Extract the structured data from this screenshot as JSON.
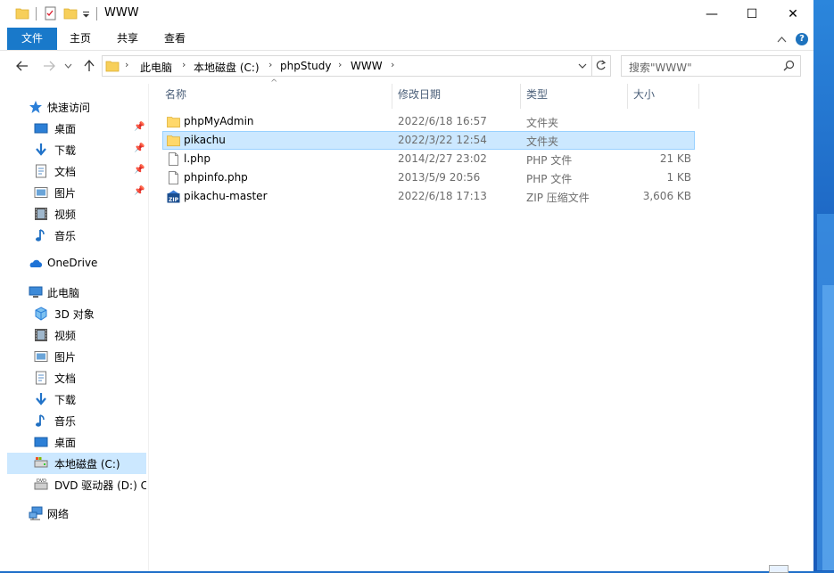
{
  "window": {
    "title": "WWW",
    "controls": {
      "minimize": "—",
      "maximize": "☐",
      "close": "✕"
    }
  },
  "ribbon": {
    "tabs": [
      "文件",
      "主页",
      "共享",
      "查看"
    ],
    "help": "?"
  },
  "address": {
    "crumbs": [
      "此电脑",
      "本地磁盘 (C:)",
      "phpStudy",
      "WWW"
    ],
    "search_placeholder": "搜索\"WWW\""
  },
  "nav": {
    "quick_access": "快速访问",
    "quick_items": [
      "桌面",
      "下载",
      "文档",
      "图片",
      "视频",
      "音乐"
    ],
    "onedrive": "OneDrive",
    "this_pc": "此电脑",
    "pc_items": [
      "3D 对象",
      "视频",
      "图片",
      "文档",
      "下载",
      "音乐",
      "桌面",
      "本地磁盘 (C:)",
      "DVD 驱动器 (D:) C"
    ],
    "network": "网络",
    "selected": "本地磁盘 (C:)"
  },
  "columns": {
    "name": "名称",
    "date": "修改日期",
    "type": "类型",
    "size": "大小"
  },
  "files": [
    {
      "name": "phpMyAdmin",
      "date": "2022/6/18 16:57",
      "type": "文件夹",
      "size": "",
      "icon": "folder-icon"
    },
    {
      "name": "pikachu",
      "date": "2022/3/22 12:54",
      "type": "文件夹",
      "size": "",
      "icon": "folder-icon",
      "selected": true
    },
    {
      "name": "l.php",
      "date": "2014/2/27 23:02",
      "type": "PHP 文件",
      "size": "21 KB",
      "icon": "file-icon"
    },
    {
      "name": "phpinfo.php",
      "date": "2013/5/9 20:56",
      "type": "PHP 文件",
      "size": "1 KB",
      "icon": "file-icon"
    },
    {
      "name": "pikachu-master",
      "date": "2022/6/18 17:13",
      "type": "ZIP 压缩文件",
      "size": "3,606 KB",
      "icon": "zip-icon"
    }
  ],
  "colors": {
    "accent": "#1979ca",
    "selection": "#cce8ff",
    "folder": "#ffd86b"
  }
}
